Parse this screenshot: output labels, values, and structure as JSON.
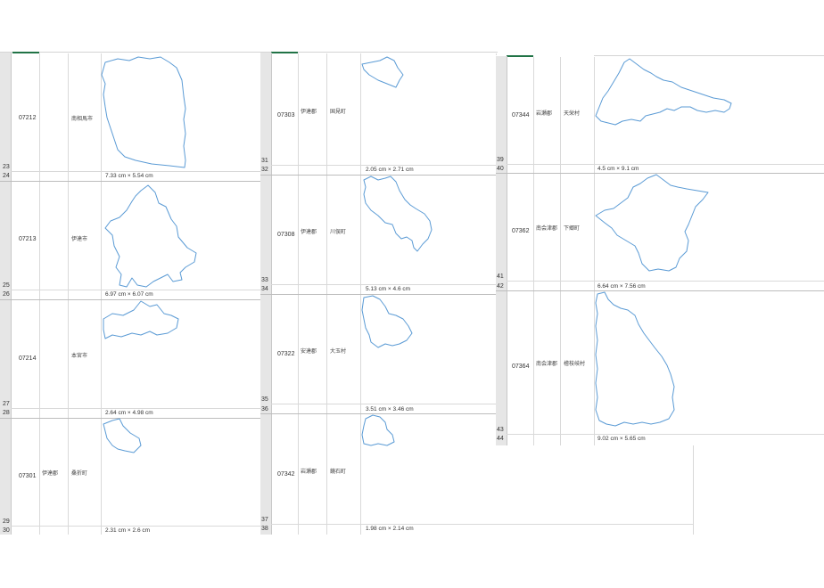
{
  "panel1": {
    "rows": [
      {
        "n": "23",
        "code": "07212",
        "city": "南相馬市",
        "n2": "24",
        "size": "7.33 cm × 5.54 cm"
      },
      {
        "n": "25",
        "code": "07213",
        "city": "伊達市",
        "n2": "26",
        "size": "6.97 cm × 6.07 cm"
      },
      {
        "n": "27",
        "code": "07214",
        "city": "本宮市",
        "n2": "28",
        "size": "2.64 cm × 4.98 cm"
      },
      {
        "n": "29",
        "code": "07301",
        "gun": "伊達郡",
        "city": "桑折町",
        "n2": "30",
        "size": "2.31 cm × 2.6 cm"
      }
    ]
  },
  "panel2": {
    "rows": [
      {
        "n": "31",
        "code": "07303",
        "gun": "伊達郡",
        "city": "国見町",
        "n2": "32",
        "size": "2.05 cm × 2.71 cm"
      },
      {
        "n": "33",
        "code": "07308",
        "gun": "伊達郡",
        "city": "川俣町",
        "n2": "34",
        "size": "5.13 cm × 4.6 cm"
      },
      {
        "n": "35",
        "code": "07322",
        "gun": "安達郡",
        "city": "大玉村",
        "n2": "36",
        "size": "3.51 cm × 3.46 cm"
      },
      {
        "n": "37",
        "code": "07342",
        "gun": "岩瀬郡",
        "city": "鏡石町",
        "n2": "38",
        "size": "1.98 cm × 2.14 cm"
      }
    ]
  },
  "panel3": {
    "rows": [
      {
        "n": "39",
        "code": "07344",
        "gun": "岩瀬郡",
        "city": "天栄村",
        "n2": "40",
        "size": "4.5 cm × 9.1 cm"
      },
      {
        "n": "41",
        "code": "07362",
        "gun": "南会津郡",
        "city": "下郷町",
        "n2": "42",
        "size": "6.64 cm × 7.56 cm"
      },
      {
        "n": "43",
        "code": "07364",
        "gun": "南会津郡",
        "city": "檜枝岐村",
        "n2": "44",
        "size": "9.02 cm × 5.65 cm"
      }
    ]
  },
  "colors": {
    "outline": "#5b9bd5",
    "rowheader": "#e6e6e6",
    "gridline": "#d9d9d9",
    "selection": "#217346"
  }
}
